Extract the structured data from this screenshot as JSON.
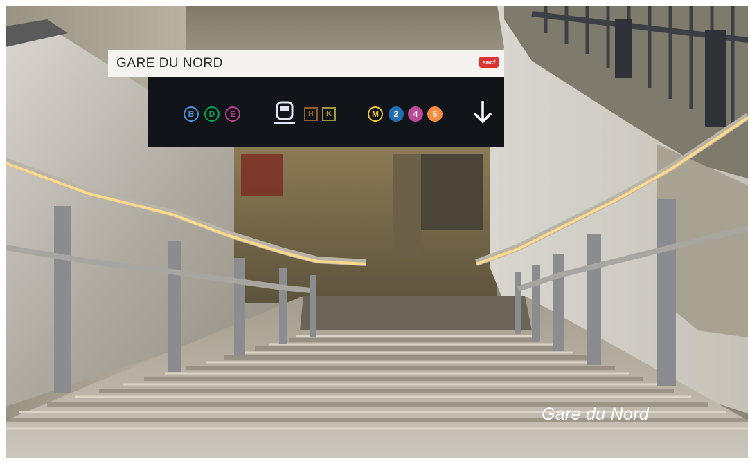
{
  "photo": {
    "description_alt": "",
    "sign": {
      "station_name": "GARE DU NORD",
      "operator_logo": "sncf",
      "rer_lines": [
        "B",
        "D",
        "E"
      ],
      "transilien_lines": [
        "H",
        "K"
      ],
      "metro_symbol": "M",
      "metro_lines": [
        "2",
        "4",
        "5"
      ],
      "direction_icon": "arrow-down-icon",
      "train_icon": "train-icon"
    },
    "caption": "Gare du Nord"
  },
  "colors": {
    "rer_b": "#4b92db",
    "rer_d": "#00a651",
    "rer_e": "#c04191",
    "line_h": "#8d5e2a",
    "line_k": "#9b9842",
    "metro_m": "#f2c931",
    "metro_2": "#216eb4",
    "metro_4": "#bb4a9b",
    "metro_5": "#f28e42",
    "sncf_red": "#e0322f"
  }
}
